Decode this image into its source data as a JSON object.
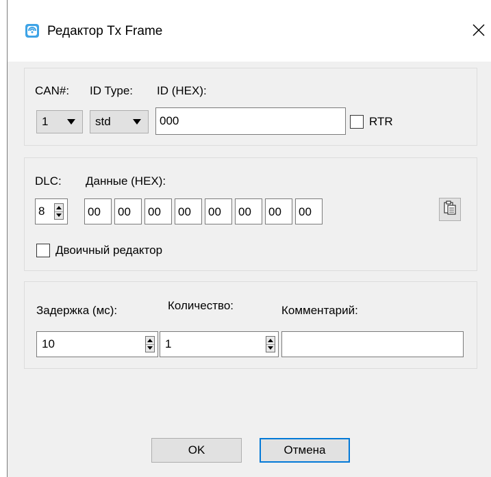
{
  "window": {
    "title": "Редактор Tx Frame",
    "close_symbol": "✕"
  },
  "id_group": {
    "can_label": "CAN#:",
    "id_type_label": "ID Type:",
    "id_hex_label": "ID (HEX):",
    "can_value": "1",
    "id_type_value": "std",
    "id_value": "000",
    "rtr_label": "RTR",
    "rtr_checked": false
  },
  "data_group": {
    "dlc_label": "DLC:",
    "data_label": "Данные (HEX):",
    "dlc_value": "8",
    "bytes": [
      "00",
      "00",
      "00",
      "00",
      "00",
      "00",
      "00",
      "00"
    ],
    "binary_editor_label": "Двоичный редактор",
    "binary_editor_checked": false
  },
  "timing_group": {
    "delay_label": "Задержка (мс):",
    "count_label": "Количество:",
    "comment_label": "Комментарий:",
    "delay_value": "10",
    "count_value": "1",
    "comment_value": ""
  },
  "buttons": {
    "ok_label": "OK",
    "cancel_label": "Отмена"
  },
  "icons": {
    "app": "app-icon",
    "close": "close-icon",
    "paste": "paste-icon",
    "spin_up": "spin-up-icon",
    "spin_down": "spin-down-icon",
    "dropdown": "dropdown-arrow-icon"
  },
  "colors": {
    "dialog_bg": "#f0f0f0",
    "titlebar_bg": "#ffffff",
    "default_button_border": "#0078d7",
    "app_icon_primary": "#3ea3e6"
  }
}
